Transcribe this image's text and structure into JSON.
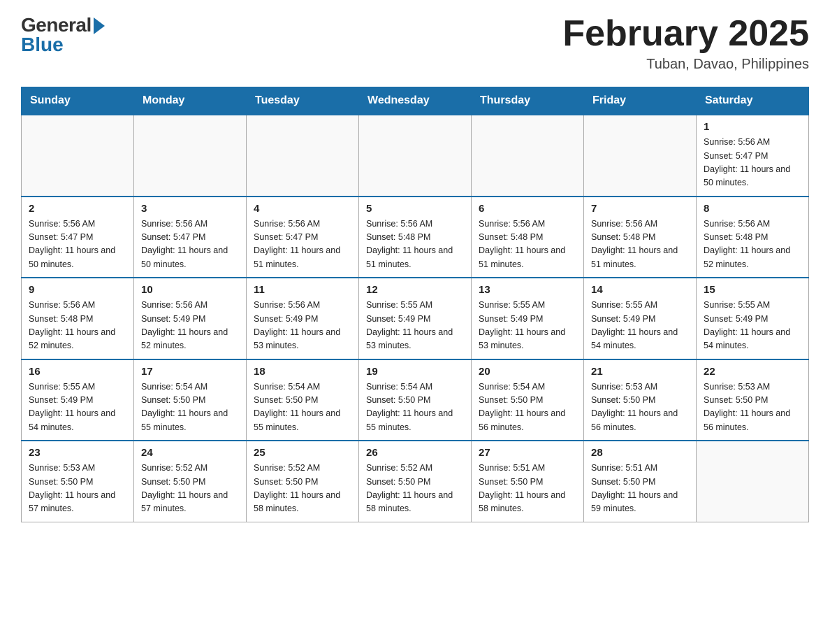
{
  "header": {
    "logo_general": "General",
    "logo_blue": "Blue",
    "month_title": "February 2025",
    "location": "Tuban, Davao, Philippines"
  },
  "days_of_week": [
    "Sunday",
    "Monday",
    "Tuesday",
    "Wednesday",
    "Thursday",
    "Friday",
    "Saturday"
  ],
  "weeks": [
    [
      {
        "day": "",
        "info": ""
      },
      {
        "day": "",
        "info": ""
      },
      {
        "day": "",
        "info": ""
      },
      {
        "day": "",
        "info": ""
      },
      {
        "day": "",
        "info": ""
      },
      {
        "day": "",
        "info": ""
      },
      {
        "day": "1",
        "info": "Sunrise: 5:56 AM\nSunset: 5:47 PM\nDaylight: 11 hours\nand 50 minutes."
      }
    ],
    [
      {
        "day": "2",
        "info": "Sunrise: 5:56 AM\nSunset: 5:47 PM\nDaylight: 11 hours\nand 50 minutes."
      },
      {
        "day": "3",
        "info": "Sunrise: 5:56 AM\nSunset: 5:47 PM\nDaylight: 11 hours\nand 50 minutes."
      },
      {
        "day": "4",
        "info": "Sunrise: 5:56 AM\nSunset: 5:47 PM\nDaylight: 11 hours\nand 51 minutes."
      },
      {
        "day": "5",
        "info": "Sunrise: 5:56 AM\nSunset: 5:48 PM\nDaylight: 11 hours\nand 51 minutes."
      },
      {
        "day": "6",
        "info": "Sunrise: 5:56 AM\nSunset: 5:48 PM\nDaylight: 11 hours\nand 51 minutes."
      },
      {
        "day": "7",
        "info": "Sunrise: 5:56 AM\nSunset: 5:48 PM\nDaylight: 11 hours\nand 51 minutes."
      },
      {
        "day": "8",
        "info": "Sunrise: 5:56 AM\nSunset: 5:48 PM\nDaylight: 11 hours\nand 52 minutes."
      }
    ],
    [
      {
        "day": "9",
        "info": "Sunrise: 5:56 AM\nSunset: 5:48 PM\nDaylight: 11 hours\nand 52 minutes."
      },
      {
        "day": "10",
        "info": "Sunrise: 5:56 AM\nSunset: 5:49 PM\nDaylight: 11 hours\nand 52 minutes."
      },
      {
        "day": "11",
        "info": "Sunrise: 5:56 AM\nSunset: 5:49 PM\nDaylight: 11 hours\nand 53 minutes."
      },
      {
        "day": "12",
        "info": "Sunrise: 5:55 AM\nSunset: 5:49 PM\nDaylight: 11 hours\nand 53 minutes."
      },
      {
        "day": "13",
        "info": "Sunrise: 5:55 AM\nSunset: 5:49 PM\nDaylight: 11 hours\nand 53 minutes."
      },
      {
        "day": "14",
        "info": "Sunrise: 5:55 AM\nSunset: 5:49 PM\nDaylight: 11 hours\nand 54 minutes."
      },
      {
        "day": "15",
        "info": "Sunrise: 5:55 AM\nSunset: 5:49 PM\nDaylight: 11 hours\nand 54 minutes."
      }
    ],
    [
      {
        "day": "16",
        "info": "Sunrise: 5:55 AM\nSunset: 5:49 PM\nDaylight: 11 hours\nand 54 minutes."
      },
      {
        "day": "17",
        "info": "Sunrise: 5:54 AM\nSunset: 5:50 PM\nDaylight: 11 hours\nand 55 minutes."
      },
      {
        "day": "18",
        "info": "Sunrise: 5:54 AM\nSunset: 5:50 PM\nDaylight: 11 hours\nand 55 minutes."
      },
      {
        "day": "19",
        "info": "Sunrise: 5:54 AM\nSunset: 5:50 PM\nDaylight: 11 hours\nand 55 minutes."
      },
      {
        "day": "20",
        "info": "Sunrise: 5:54 AM\nSunset: 5:50 PM\nDaylight: 11 hours\nand 56 minutes."
      },
      {
        "day": "21",
        "info": "Sunrise: 5:53 AM\nSunset: 5:50 PM\nDaylight: 11 hours\nand 56 minutes."
      },
      {
        "day": "22",
        "info": "Sunrise: 5:53 AM\nSunset: 5:50 PM\nDaylight: 11 hours\nand 56 minutes."
      }
    ],
    [
      {
        "day": "23",
        "info": "Sunrise: 5:53 AM\nSunset: 5:50 PM\nDaylight: 11 hours\nand 57 minutes."
      },
      {
        "day": "24",
        "info": "Sunrise: 5:52 AM\nSunset: 5:50 PM\nDaylight: 11 hours\nand 57 minutes."
      },
      {
        "day": "25",
        "info": "Sunrise: 5:52 AM\nSunset: 5:50 PM\nDaylight: 11 hours\nand 58 minutes."
      },
      {
        "day": "26",
        "info": "Sunrise: 5:52 AM\nSunset: 5:50 PM\nDaylight: 11 hours\nand 58 minutes."
      },
      {
        "day": "27",
        "info": "Sunrise: 5:51 AM\nSunset: 5:50 PM\nDaylight: 11 hours\nand 58 minutes."
      },
      {
        "day": "28",
        "info": "Sunrise: 5:51 AM\nSunset: 5:50 PM\nDaylight: 11 hours\nand 59 minutes."
      },
      {
        "day": "",
        "info": ""
      }
    ]
  ]
}
